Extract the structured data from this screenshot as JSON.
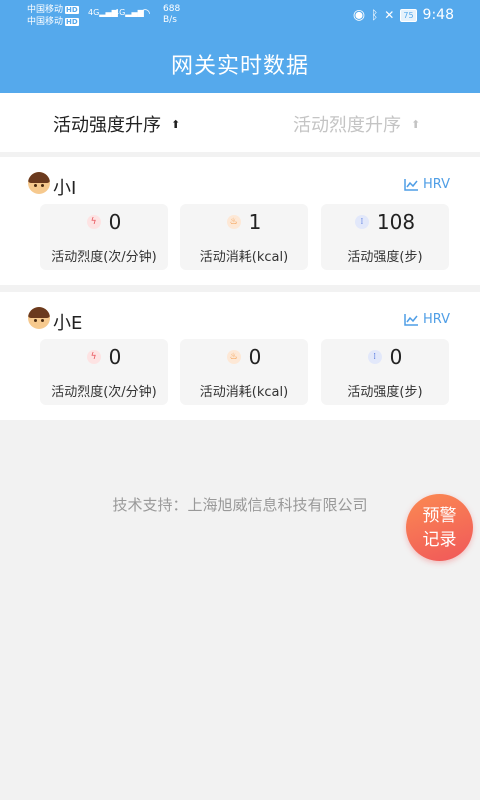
{
  "status_bar": {
    "carrier1": "中国移动",
    "carrier2": "中国移动",
    "hd": "HD",
    "network": "4G",
    "speed_value": "688",
    "speed_unit": "B/s",
    "battery": "75",
    "time": "9:48"
  },
  "header": {
    "title": "网关实时数据"
  },
  "sort": {
    "active_label": "活动强度升序",
    "inactive_label": "活动烈度升序"
  },
  "members": [
    {
      "name": "小I",
      "hrv_label": "HRV",
      "metrics": [
        {
          "value": "0",
          "label": "活动烈度(次/分钟)",
          "icon": "lightning-icon"
        },
        {
          "value": "1",
          "label": "活动消耗(kcal)",
          "icon": "flame-icon"
        },
        {
          "value": "108",
          "label": "活动强度(步)",
          "icon": "footprint-icon"
        }
      ]
    },
    {
      "name": "小E",
      "hrv_label": "HRV",
      "metrics": [
        {
          "value": "0",
          "label": "活动烈度(次/分钟)",
          "icon": "lightning-icon"
        },
        {
          "value": "0",
          "label": "活动消耗(kcal)",
          "icon": "flame-icon"
        },
        {
          "value": "0",
          "label": "活动强度(步)",
          "icon": "footprint-icon"
        }
      ]
    }
  ],
  "footer": {
    "support_text": "技术支持：上海旭威信息科技有限公司"
  },
  "fab": {
    "line1": "预警",
    "line2": "记录"
  },
  "colors": {
    "header": "#55a9ec",
    "accent": "#4f9ee6",
    "fab_start": "#fb8a52",
    "fab_end": "#f0575a"
  }
}
